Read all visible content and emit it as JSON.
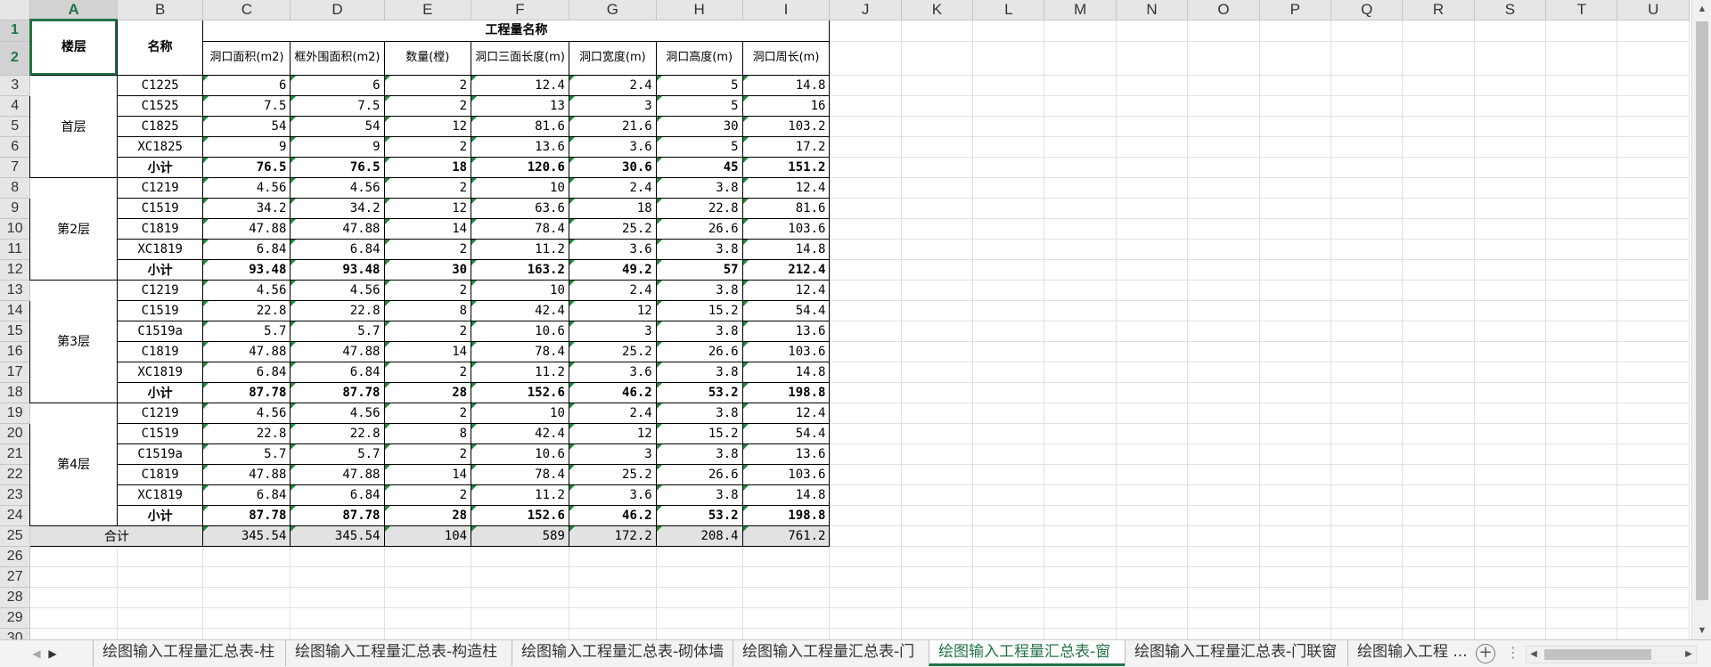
{
  "columns": [
    "A",
    "B",
    "C",
    "D",
    "E",
    "F",
    "G",
    "H",
    "I",
    "J",
    "K",
    "L",
    "M",
    "N",
    "O",
    "P",
    "Q",
    "R",
    "S",
    "T",
    "U"
  ],
  "header": {
    "floor_label": "楼层",
    "name_label": "名称",
    "group_label": "工程量名称",
    "fields": [
      "洞口面积(m2)",
      "框外围面积(m2)",
      "数量(樘)",
      "洞口三面长度(m)",
      "洞口宽度(m)",
      "洞口高度(m)",
      "洞口周长(m)"
    ]
  },
  "floors": [
    {
      "floor": "首层",
      "items": [
        {
          "name": "C1225",
          "values": [
            "6",
            "6",
            "2",
            "12.4",
            "2.4",
            "5",
            "14.8"
          ]
        },
        {
          "name": "C1525",
          "values": [
            "7.5",
            "7.5",
            "2",
            "13",
            "3",
            "5",
            "16"
          ]
        },
        {
          "name": "C1825",
          "values": [
            "54",
            "54",
            "12",
            "81.6",
            "21.6",
            "30",
            "103.2"
          ]
        },
        {
          "name": "XC1825",
          "values": [
            "9",
            "9",
            "2",
            "13.6",
            "3.6",
            "5",
            "17.2"
          ]
        }
      ],
      "subtotal": [
        "76.5",
        "76.5",
        "18",
        "120.6",
        "30.6",
        "45",
        "151.2"
      ]
    },
    {
      "floor": "第2层",
      "items": [
        {
          "name": "C1219",
          "values": [
            "4.56",
            "4.56",
            "2",
            "10",
            "2.4",
            "3.8",
            "12.4"
          ]
        },
        {
          "name": "C1519",
          "values": [
            "34.2",
            "34.2",
            "12",
            "63.6",
            "18",
            "22.8",
            "81.6"
          ]
        },
        {
          "name": "C1819",
          "values": [
            "47.88",
            "47.88",
            "14",
            "78.4",
            "25.2",
            "26.6",
            "103.6"
          ]
        },
        {
          "name": "XC1819",
          "values": [
            "6.84",
            "6.84",
            "2",
            "11.2",
            "3.6",
            "3.8",
            "14.8"
          ]
        }
      ],
      "subtotal": [
        "93.48",
        "93.48",
        "30",
        "163.2",
        "49.2",
        "57",
        "212.4"
      ]
    },
    {
      "floor": "第3层",
      "items": [
        {
          "name": "C1219",
          "values": [
            "4.56",
            "4.56",
            "2",
            "10",
            "2.4",
            "3.8",
            "12.4"
          ]
        },
        {
          "name": "C1519",
          "values": [
            "22.8",
            "22.8",
            "8",
            "42.4",
            "12",
            "15.2",
            "54.4"
          ]
        },
        {
          "name": "C1519a",
          "values": [
            "5.7",
            "5.7",
            "2",
            "10.6",
            "3",
            "3.8",
            "13.6"
          ]
        },
        {
          "name": "C1819",
          "values": [
            "47.88",
            "47.88",
            "14",
            "78.4",
            "25.2",
            "26.6",
            "103.6"
          ]
        },
        {
          "name": "XC1819",
          "values": [
            "6.84",
            "6.84",
            "2",
            "11.2",
            "3.6",
            "3.8",
            "14.8"
          ]
        }
      ],
      "subtotal": [
        "87.78",
        "87.78",
        "28",
        "152.6",
        "46.2",
        "53.2",
        "198.8"
      ]
    },
    {
      "floor": "第4层",
      "items": [
        {
          "name": "C1219",
          "values": [
            "4.56",
            "4.56",
            "2",
            "10",
            "2.4",
            "3.8",
            "12.4"
          ]
        },
        {
          "name": "C1519",
          "values": [
            "22.8",
            "22.8",
            "8",
            "42.4",
            "12",
            "15.2",
            "54.4"
          ]
        },
        {
          "name": "C1519a",
          "values": [
            "5.7",
            "5.7",
            "2",
            "10.6",
            "3",
            "3.8",
            "13.6"
          ]
        },
        {
          "name": "C1819",
          "values": [
            "47.88",
            "47.88",
            "14",
            "78.4",
            "25.2",
            "26.6",
            "103.6"
          ]
        },
        {
          "name": "XC1819",
          "values": [
            "6.84",
            "6.84",
            "2",
            "11.2",
            "3.6",
            "3.8",
            "14.8"
          ]
        }
      ],
      "subtotal": [
        "87.78",
        "87.78",
        "28",
        "152.6",
        "46.2",
        "53.2",
        "198.8"
      ]
    }
  ],
  "subtotal_label": "小计",
  "total": {
    "label": "合计",
    "values": [
      "345.54",
      "345.54",
      "104",
      "589",
      "172.2",
      "208.4",
      "761.2"
    ]
  },
  "visible_rows": 30,
  "sheet_tabs": [
    {
      "label": "绘图输入工程量汇总表-柱",
      "active": false
    },
    {
      "label": "绘图输入工程量汇总表-构造柱",
      "active": false
    },
    {
      "label": "绘图输入工程量汇总表-砌体墙",
      "active": false
    },
    {
      "label": "绘图输入工程量汇总表-门",
      "active": false
    },
    {
      "label": "绘图输入工程量汇总表-窗",
      "active": true
    },
    {
      "label": "绘图输入工程量汇总表-门联窗",
      "active": false
    },
    {
      "label": "绘图输入工程 ...",
      "active": false
    }
  ],
  "icons": {
    "prev": "triangle-left-icon",
    "next": "triangle-right-icon",
    "add": "plus-circle-icon",
    "more": "ellipsis-icon"
  },
  "accent_color": "#217346"
}
